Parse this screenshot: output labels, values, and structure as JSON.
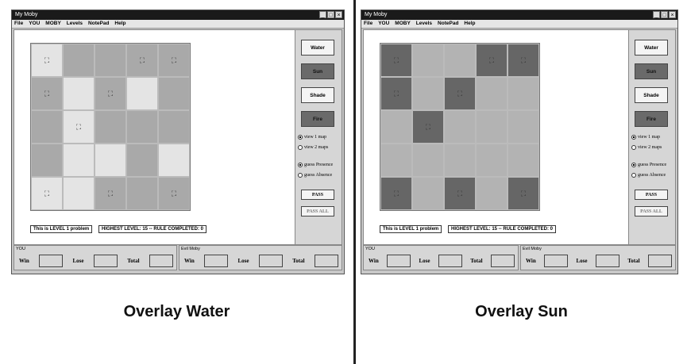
{
  "panels": [
    {
      "title": "My Moby",
      "menu": [
        "File",
        "YOU",
        "MOBY",
        "Levels",
        "NotePad",
        "Help"
      ],
      "grid": [
        [
          {
            "c": "#e4e4e4",
            "moby": true
          },
          {
            "c": "#a9a9a9",
            "moby": false
          },
          {
            "c": "#a9a9a9",
            "moby": false
          },
          {
            "c": "#a9a9a9",
            "moby": true
          },
          {
            "c": "#a9a9a9",
            "moby": true
          }
        ],
        [
          {
            "c": "#a9a9a9",
            "moby": true
          },
          {
            "c": "#e4e4e4",
            "moby": false
          },
          {
            "c": "#a9a9a9",
            "moby": true
          },
          {
            "c": "#e4e4e4",
            "moby": false
          },
          {
            "c": "#a9a9a9",
            "moby": false
          }
        ],
        [
          {
            "c": "#a9a9a9",
            "moby": false
          },
          {
            "c": "#e4e4e4",
            "moby": true
          },
          {
            "c": "#a9a9a9",
            "moby": false
          },
          {
            "c": "#a9a9a9",
            "moby": false
          },
          {
            "c": "#a9a9a9",
            "moby": false
          }
        ],
        [
          {
            "c": "#a9a9a9",
            "moby": false
          },
          {
            "c": "#e4e4e4",
            "moby": false
          },
          {
            "c": "#e4e4e4",
            "moby": false
          },
          {
            "c": "#a9a9a9",
            "moby": false
          },
          {
            "c": "#e4e4e4",
            "moby": false
          }
        ],
        [
          {
            "c": "#e4e4e4",
            "moby": true
          },
          {
            "c": "#e4e4e4",
            "moby": false
          },
          {
            "c": "#a9a9a9",
            "moby": true
          },
          {
            "c": "#a9a9a9",
            "moby": false
          },
          {
            "c": "#a9a9a9",
            "moby": true
          }
        ]
      ],
      "level_text": "This is LEVEL 1 problem",
      "highest_text": "HIGHEST LEVEL: 15 -- RULE COMPLETED: 0",
      "buttons": [
        {
          "label": "Water",
          "color": "#f4f4f4"
        },
        {
          "label": "Sun",
          "color": "#6a6a6a"
        },
        {
          "label": "Shade",
          "color": "#f4f4f4"
        },
        {
          "label": "Fire",
          "color": "#6a6a6a"
        }
      ],
      "view_options": [
        "view 1 map",
        "view 2 maps"
      ],
      "guess_options": [
        "guess Presence",
        "guess Absence"
      ],
      "pass_label": "PASS",
      "pass_all_label": "PASS ALL",
      "you_label": "YOU",
      "evil_label": "Evil Moby",
      "win_label": "Win",
      "lose_label": "Lose",
      "total_label": "Total",
      "caption": "Overlay Water"
    },
    {
      "title": "My Moby",
      "menu": [
        "File",
        "YOU",
        "MOBY",
        "Levels",
        "NotePad",
        "Help"
      ],
      "grid": [
        [
          {
            "c": "#666666",
            "moby": true
          },
          {
            "c": "#b3b3b3",
            "moby": false
          },
          {
            "c": "#b3b3b3",
            "moby": false
          },
          {
            "c": "#666666",
            "moby": true
          },
          {
            "c": "#666666",
            "moby": true
          }
        ],
        [
          {
            "c": "#666666",
            "moby": true
          },
          {
            "c": "#b3b3b3",
            "moby": false
          },
          {
            "c": "#666666",
            "moby": true
          },
          {
            "c": "#b3b3b3",
            "moby": false
          },
          {
            "c": "#b3b3b3",
            "moby": false
          }
        ],
        [
          {
            "c": "#b3b3b3",
            "moby": false
          },
          {
            "c": "#666666",
            "moby": true
          },
          {
            "c": "#b3b3b3",
            "moby": false
          },
          {
            "c": "#b3b3b3",
            "moby": false
          },
          {
            "c": "#b3b3b3",
            "moby": false
          }
        ],
        [
          {
            "c": "#b3b3b3",
            "moby": false
          },
          {
            "c": "#b3b3b3",
            "moby": false
          },
          {
            "c": "#b3b3b3",
            "moby": false
          },
          {
            "c": "#b3b3b3",
            "moby": false
          },
          {
            "c": "#b3b3b3",
            "moby": false
          }
        ],
        [
          {
            "c": "#666666",
            "moby": true
          },
          {
            "c": "#b3b3b3",
            "moby": false
          },
          {
            "c": "#666666",
            "moby": true
          },
          {
            "c": "#b3b3b3",
            "moby": false
          },
          {
            "c": "#666666",
            "moby": true
          }
        ]
      ],
      "level_text": "This is LEVEL 1 problem",
      "highest_text": "HIGHEST LEVEL: 15 -- RULE COMPLETED: 0",
      "buttons": [
        {
          "label": "Water",
          "color": "#f4f4f4"
        },
        {
          "label": "Sun",
          "color": "#6a6a6a"
        },
        {
          "label": "Shade",
          "color": "#f4f4f4"
        },
        {
          "label": "Fire",
          "color": "#6a6a6a"
        }
      ],
      "view_options": [
        "view 1 map",
        "view 2 maps"
      ],
      "guess_options": [
        "guess Presence",
        "guess Absence"
      ],
      "pass_label": "PASS",
      "pass_all_label": "PASS ALL",
      "you_label": "YOU",
      "evil_label": "Evil Moby",
      "win_label": "Win",
      "lose_label": "Lose",
      "total_label": "Total",
      "caption": "Overlay Sun"
    }
  ]
}
